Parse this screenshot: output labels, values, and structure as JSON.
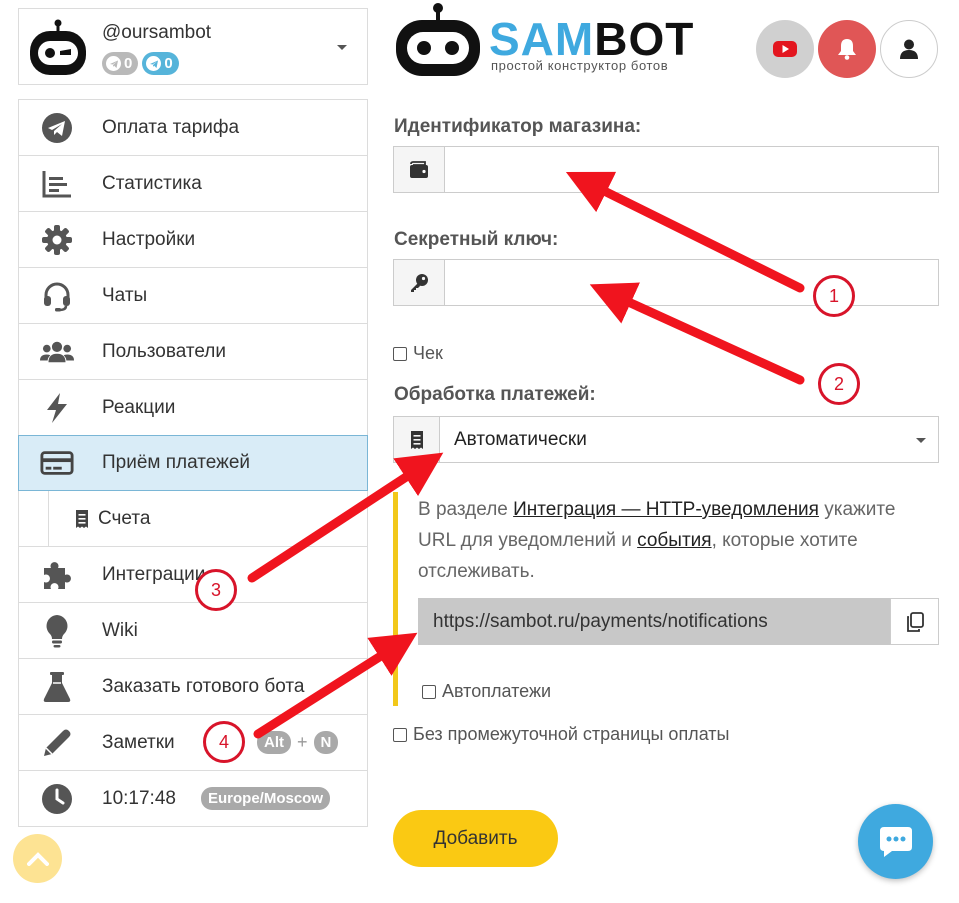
{
  "account": {
    "username": "@oursambot",
    "badge_gray_count": "0",
    "badge_blue_count": "0"
  },
  "menu": {
    "items": [
      {
        "label": "Оплата тарифа",
        "icon": "telegram-icon"
      },
      {
        "label": "Статистика",
        "icon": "chart-icon"
      },
      {
        "label": "Настройки",
        "icon": "gear-icon"
      },
      {
        "label": "Чаты",
        "icon": "headset-icon"
      },
      {
        "label": "Пользователи",
        "icon": "users-icon"
      },
      {
        "label": "Реакции",
        "icon": "lightning-icon"
      },
      {
        "label": "Приём платежей",
        "icon": "credit-card-icon",
        "active": true
      },
      {
        "label": "Счета",
        "icon": "receipt-icon",
        "sub": true
      },
      {
        "label": "Интеграции",
        "icon": "puzzle-icon"
      },
      {
        "label": "Wiki",
        "icon": "lightbulb-icon"
      },
      {
        "label": "Заказать готового бота",
        "icon": "flask-icon"
      },
      {
        "label": "Заметки",
        "icon": "pen-icon"
      },
      {
        "label": "10:17:48",
        "icon": "clock-icon"
      }
    ],
    "shortcut": {
      "key1": "Alt",
      "plus": "+",
      "key2": "N"
    },
    "timezone": "Europe/Moscow"
  },
  "header": {
    "logo_sam": "SAM",
    "logo_bot": "BOT",
    "tagline": "простой конструктор ботов"
  },
  "form": {
    "shop_id_label": "Идентификатор магазина:",
    "shop_id_value": "",
    "secret_key_label": "Секретный ключ:",
    "secret_key_value": "",
    "receipt_label": "Чек",
    "processing_label": "Обработка платежей:",
    "processing_value": "Автоматически",
    "info": {
      "part1": "В разделе ",
      "link1": "Интеграция — HTTP-уведомления",
      "part2": " укажите URL для уведомлений и ",
      "link2": "события",
      "part3": ", которые хотите отслеживать."
    },
    "notification_url": "https://sambot.ru/payments/notifications",
    "autopay_label": "Автоплатежи",
    "no_intermediate_label": "Без промежуточной страницы оплаты",
    "submit_label": "Добавить"
  },
  "annotations": [
    "1",
    "2",
    "3",
    "4"
  ],
  "colors": {
    "brand_blue": "#3fa9df",
    "accent_yellow": "#fac913",
    "annotation_red": "#d8142a",
    "active_bg": "#d9ecf7"
  }
}
